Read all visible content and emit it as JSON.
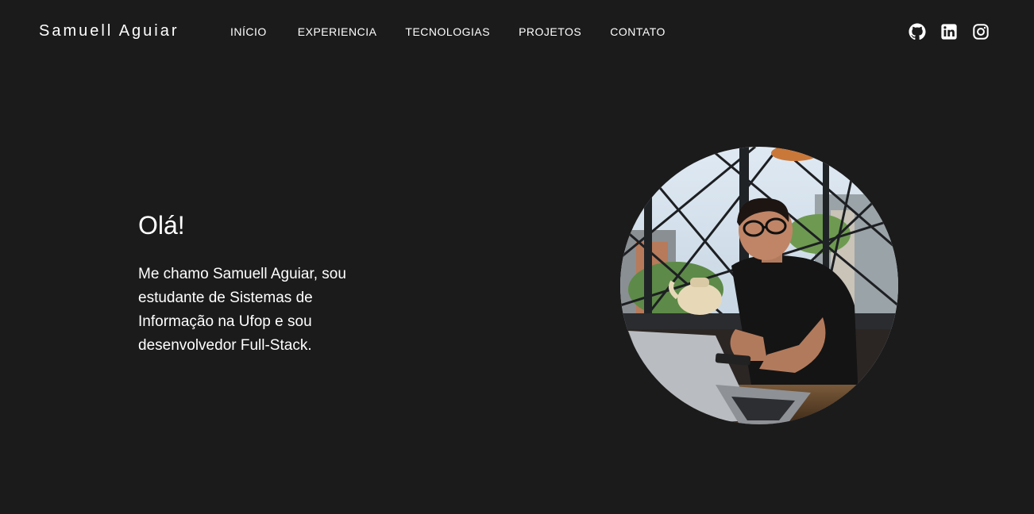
{
  "header": {
    "brand": "Samuell Aguiar",
    "nav": [
      "INÍCIO",
      "EXPERIENCIA",
      "TECNOLOGIAS",
      "PROJETOS",
      "CONTATO"
    ],
    "social_icons": [
      "github-icon",
      "linkedin-icon",
      "instagram-icon"
    ]
  },
  "hero": {
    "greeting": "Olá!",
    "description": "Me chamo Samuell Aguiar, sou estudante de Sistemas de Informação na Ufop e sou desenvolvedor Full-Stack."
  },
  "colors": {
    "background": "#1b1b1b",
    "text": "#ffffff"
  }
}
